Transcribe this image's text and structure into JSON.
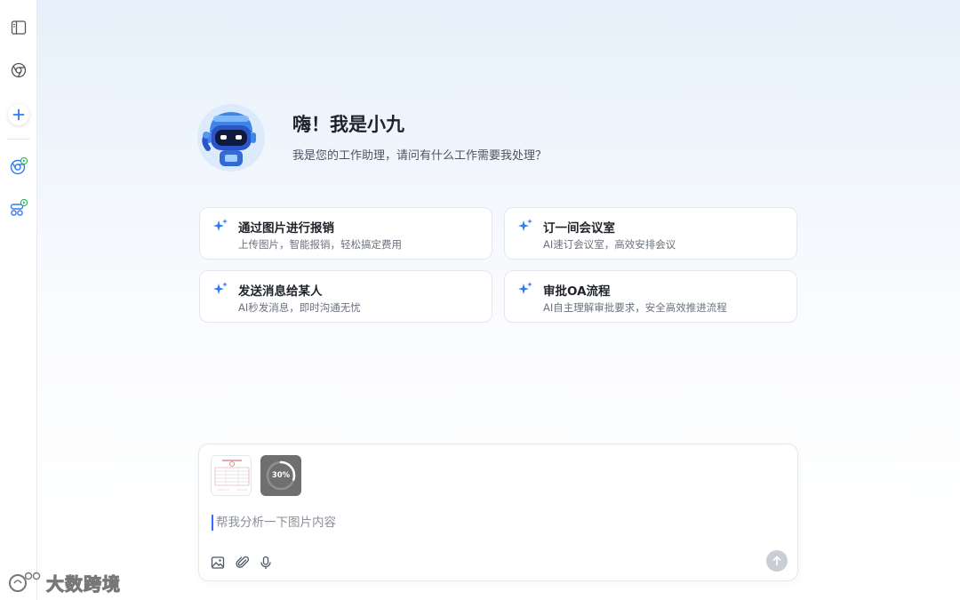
{
  "sidebar": {
    "items": [
      {
        "icon": "sidebar-toggle-icon"
      },
      {
        "icon": "chrome-icon"
      },
      {
        "icon": "plus-icon"
      },
      {
        "icon": "ai-browser-icon"
      },
      {
        "icon": "ai-workflow-icon"
      }
    ]
  },
  "header": {
    "title": "嗨！我是小九",
    "subtitle": "我是您的工作助理，请问有什么工作需要我处理？"
  },
  "cards": [
    {
      "title": "通过图片进行报销",
      "subtitle": "上传图片，智能报销，轻松搞定费用"
    },
    {
      "title": "订一间会议室",
      "subtitle": "AI速订会议室，高效安排会议"
    },
    {
      "title": "发送消息给某人",
      "subtitle": "AI秒发消息，即时沟通无忧"
    },
    {
      "title": "审批OA流程",
      "subtitle": "AI自主理解审批要求，安全高效推进流程"
    }
  ],
  "composer": {
    "attachments": [
      {
        "type": "document-thumbnail"
      },
      {
        "type": "upload-progress",
        "progress_label": "30%",
        "progress": 0.3
      }
    ],
    "text": "帮我分析一下图片内容",
    "tools": [
      "image-icon",
      "paperclip-icon",
      "microphone-icon"
    ],
    "send_icon": "arrow-up-icon"
  },
  "watermark": {
    "text": "大数跨境"
  },
  "colors": {
    "accent": "#3370ff",
    "spark": "#2f7bf5",
    "send_disabled": "#c9cdd4"
  }
}
